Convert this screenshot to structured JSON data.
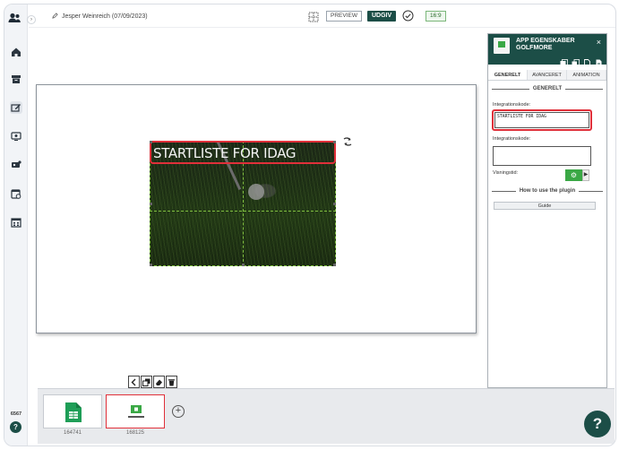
{
  "topbar": {
    "author": "Jesper Weinreich (07/09/2023)",
    "preview_label": "PREVIEW",
    "publish_label": "UDGIV",
    "ratio_label": "16:9"
  },
  "sidebar": {
    "number": "6567",
    "help": "?"
  },
  "slide_element": {
    "title": "STARTLISTE FOR IDAG"
  },
  "filmstrip": {
    "slides": [
      {
        "label": "164741"
      },
      {
        "label": "168125"
      }
    ],
    "add_label": "+"
  },
  "panel": {
    "title": "APP EGENSKABER GOLFMORE",
    "close": "×",
    "tabs": [
      "GENERELT",
      "AVANCERET",
      "ANIMATION"
    ],
    "section": "GENERELT",
    "field1_label": "Integrationskode:",
    "field1_value": "STARTLISTE FOR IDAG",
    "field2_label": "Integrationskode:",
    "field2_value": "",
    "time_label": "Visningstid:",
    "howto": "How to use the plugin",
    "guide_button": "Guide"
  },
  "help_fab": "?"
}
